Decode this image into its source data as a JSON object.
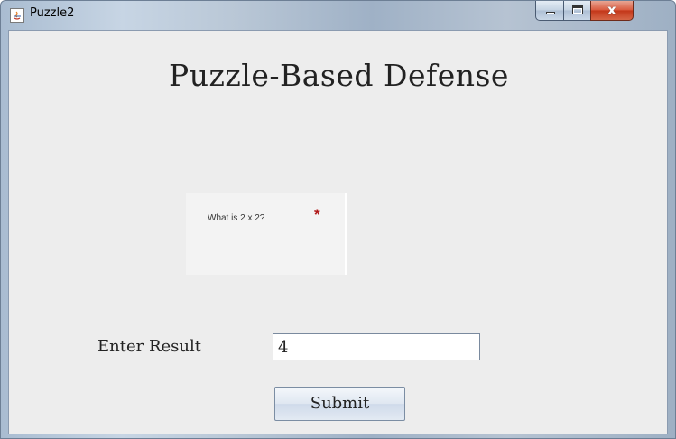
{
  "window": {
    "title": "Puzzle2",
    "icon": "java-app-icon",
    "controls": {
      "minimize_icon": "minimize-icon",
      "maximize_icon": "maximize-icon",
      "close_icon": "close-icon",
      "close_glyph": "x"
    }
  },
  "main": {
    "heading": "Puzzle-Based Defense",
    "captcha": {
      "question": "What is 2 x 2?",
      "required_marker": "*",
      "required_color": "#b01818"
    },
    "result": {
      "label": "Enter Result",
      "value": "4"
    },
    "submit_label": "Submit"
  }
}
